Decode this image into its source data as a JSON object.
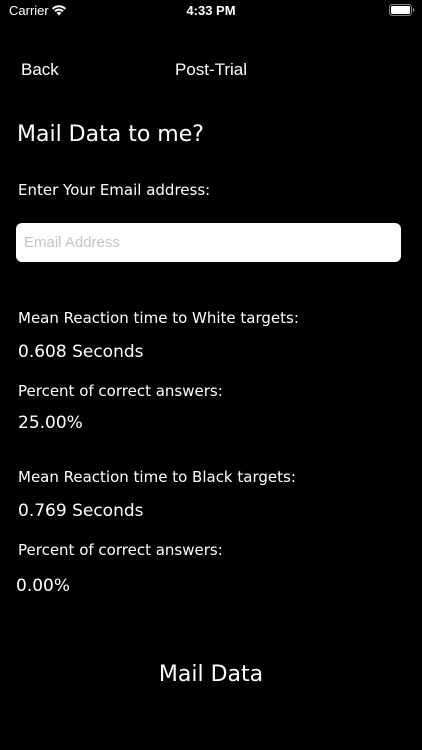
{
  "status_bar": {
    "carrier": "Carrier",
    "time": "4:33 PM",
    "wifi_icon": "wifi-icon",
    "battery_icon": "battery-icon"
  },
  "nav": {
    "back_label": "Back",
    "title": "Post-Trial"
  },
  "mail": {
    "heading": "Mail Data to me?",
    "prompt": "Enter Your Email address:",
    "email_placeholder": "Email Address",
    "email_value": ""
  },
  "white_targets": {
    "reaction_label": "Mean Reaction time to White targets:",
    "reaction_value": "0.608 Seconds",
    "correct_label": "Percent of correct answers:",
    "correct_value": "25.00%"
  },
  "black_targets": {
    "reaction_label": "Mean Reaction time to Black targets:",
    "reaction_value": "0.769 Seconds",
    "correct_label": "Percent of correct answers:",
    "correct_value": "0.00%"
  },
  "actions": {
    "mail_button_label": "Mail Data"
  },
  "colors": {
    "background": "#000000",
    "text": "#ffffff",
    "field_background": "#ffffff",
    "placeholder": "#c4c4c6"
  }
}
